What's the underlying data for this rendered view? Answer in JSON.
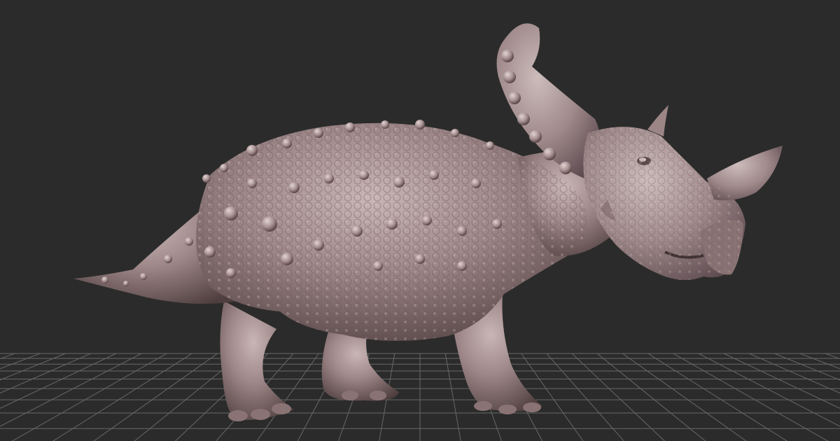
{
  "viewport": {
    "background": "#2b2b2b",
    "grid_color": "#9a9a9a",
    "model_color": "#9c8585",
    "model_highlight": "#c8b4b4",
    "model_shadow": "#4f3e3f"
  },
  "model": {
    "subject": "dinosaur-sculpt-icon"
  }
}
